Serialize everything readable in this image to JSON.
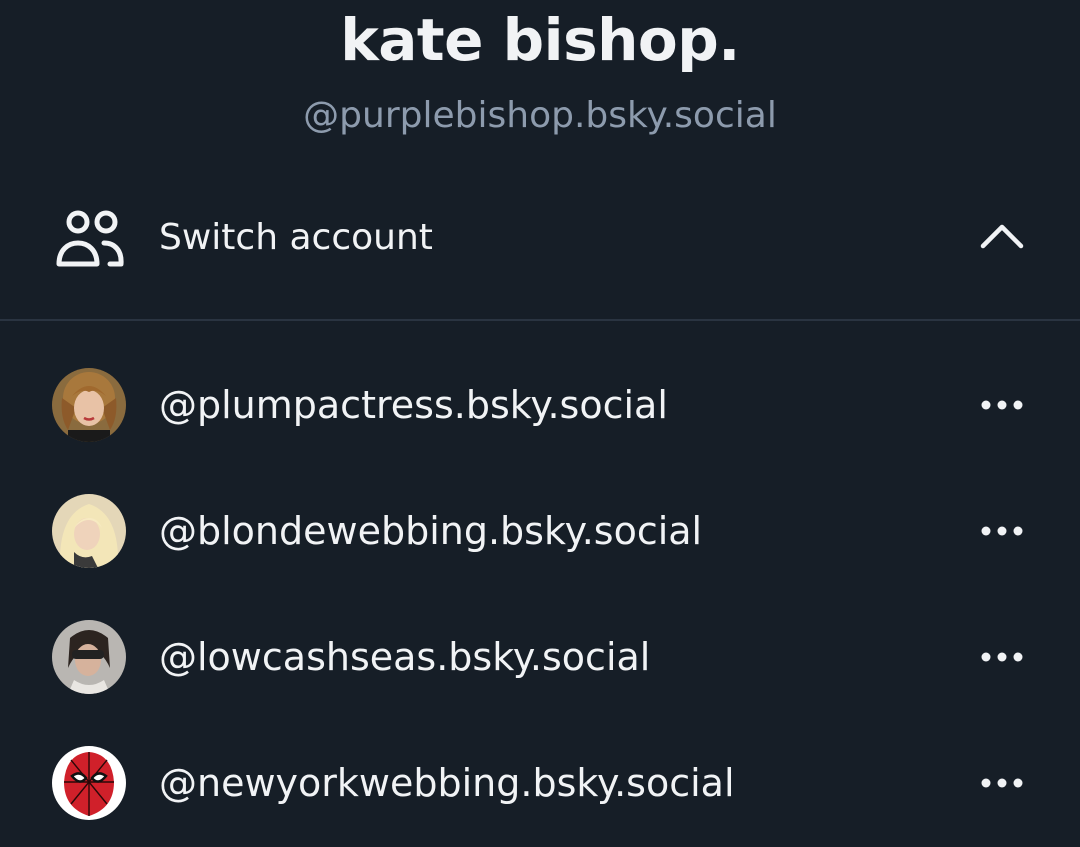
{
  "profile": {
    "display_name": "kate bishop.",
    "handle": "@purplebishop.bsky.social"
  },
  "switch_account": {
    "label": "Switch account",
    "icon": "users-icon",
    "toggle_icon": "chevron-up-icon"
  },
  "accounts": [
    {
      "handle": "@plumpactress.bsky.social",
      "avatar": "avatar-photo",
      "menu_icon": "more-horizontal-icon"
    },
    {
      "handle": "@blondewebbing.bsky.social",
      "avatar": "avatar-photo",
      "menu_icon": "more-horizontal-icon"
    },
    {
      "handle": "@lowcashseas.bsky.social",
      "avatar": "avatar-photo",
      "menu_icon": "more-horizontal-icon"
    },
    {
      "handle": "@newyorkwebbing.bsky.social",
      "avatar": "avatar-spiderman-mask",
      "menu_icon": "more-horizontal-icon"
    }
  ],
  "colors": {
    "background": "#161e27",
    "text": "#f1f3f5",
    "muted_text": "#8d9bad",
    "divider": "#2a3441"
  }
}
